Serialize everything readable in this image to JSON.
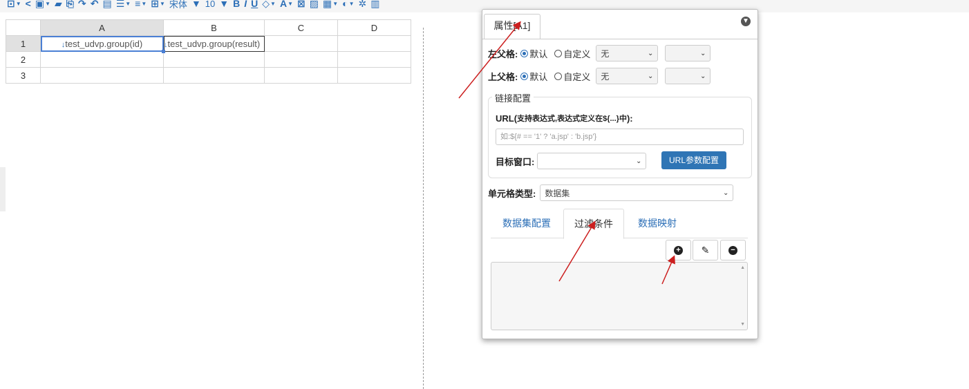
{
  "toolbar": {
    "font_name": "宋体",
    "font_size": "10",
    "bold": "B",
    "italic": "I",
    "underline": "U"
  },
  "grid": {
    "columns": [
      "A",
      "B",
      "C",
      "D"
    ],
    "rows": [
      "1",
      "2",
      "3"
    ],
    "cell_a1": "test_udvp.group(id)",
    "cell_b1": "test_udvp.group(result)"
  },
  "panel": {
    "tab_label": "属性[A1]",
    "left_parent_label": "左父格:",
    "top_parent_label": "上父格:",
    "radio_default": "默认",
    "radio_custom": "自定义",
    "select_none": "无",
    "link_config_legend": "链接配置",
    "url_label_bold": "URL(",
    "url_label_rest": "支持表达式,表达式定义在${...}中",
    "url_label_end": "):",
    "url_placeholder": "如:${# == '1' ? 'a.jsp' : 'b.jsp'}",
    "target_window_label": "目标窗口:",
    "url_param_button": "URL参数配置",
    "cell_type_label": "单元格类型:",
    "cell_type_value": "数据集",
    "tabs": [
      "数据集配置",
      "过滤条件",
      "数据映射"
    ]
  },
  "colors": {
    "accent": "#2c6fb7",
    "button_blue": "#2f75b5",
    "annotation_arrow": "#cc1f1f"
  }
}
